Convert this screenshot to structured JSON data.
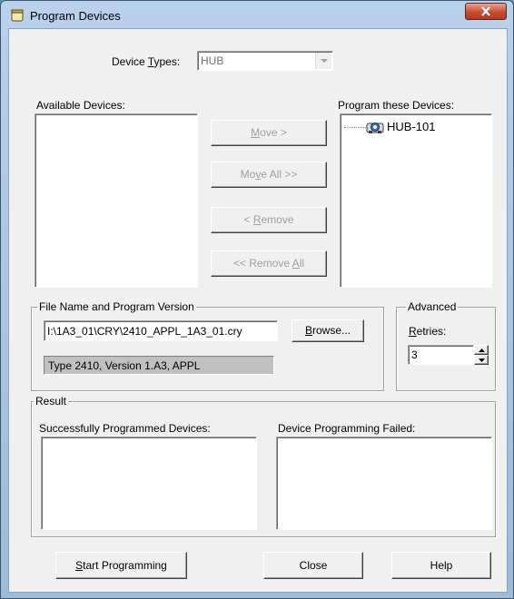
{
  "window": {
    "title": "Program Devices"
  },
  "device_types": {
    "label_pre": "Device ",
    "label_accel": "T",
    "label_post": "ypes:",
    "value": "HUB"
  },
  "available_devices": {
    "label": "Available Devices:"
  },
  "program_devices": {
    "label": "Program these Devices:",
    "items": [
      "HUB-101"
    ]
  },
  "move_buttons": {
    "move": {
      "pre": "",
      "accel": "M",
      "post": "ove >"
    },
    "move_all": {
      "pre": "Mo",
      "accel": "v",
      "post": "e All >>"
    },
    "remove": {
      "pre": "< ",
      "accel": "R",
      "post": "emove"
    },
    "remove_all": {
      "pre": "<< Remove ",
      "accel": "A",
      "post": "ll"
    }
  },
  "file_group": {
    "legend": "File Name and Program Version",
    "path": "I:\\1A3_01\\CRY\\2410_APPL_1A3_01.cry",
    "version": "Type 2410, Version 1.A3, APPL",
    "browse": {
      "pre": "",
      "accel": "B",
      "post": "rowse..."
    }
  },
  "advanced_group": {
    "legend": "Advanced",
    "retries_label": {
      "pre": "",
      "accel": "R",
      "post": "etries:"
    },
    "retries_value": "3"
  },
  "result_group": {
    "legend": "Result",
    "success_label": "Successfully Programmed Devices:",
    "failed_label": "Device Programming Failed:"
  },
  "bottom_buttons": {
    "start": {
      "pre": "",
      "accel": "S",
      "post": "tart Programming"
    },
    "close": "Close",
    "help": "Help"
  }
}
